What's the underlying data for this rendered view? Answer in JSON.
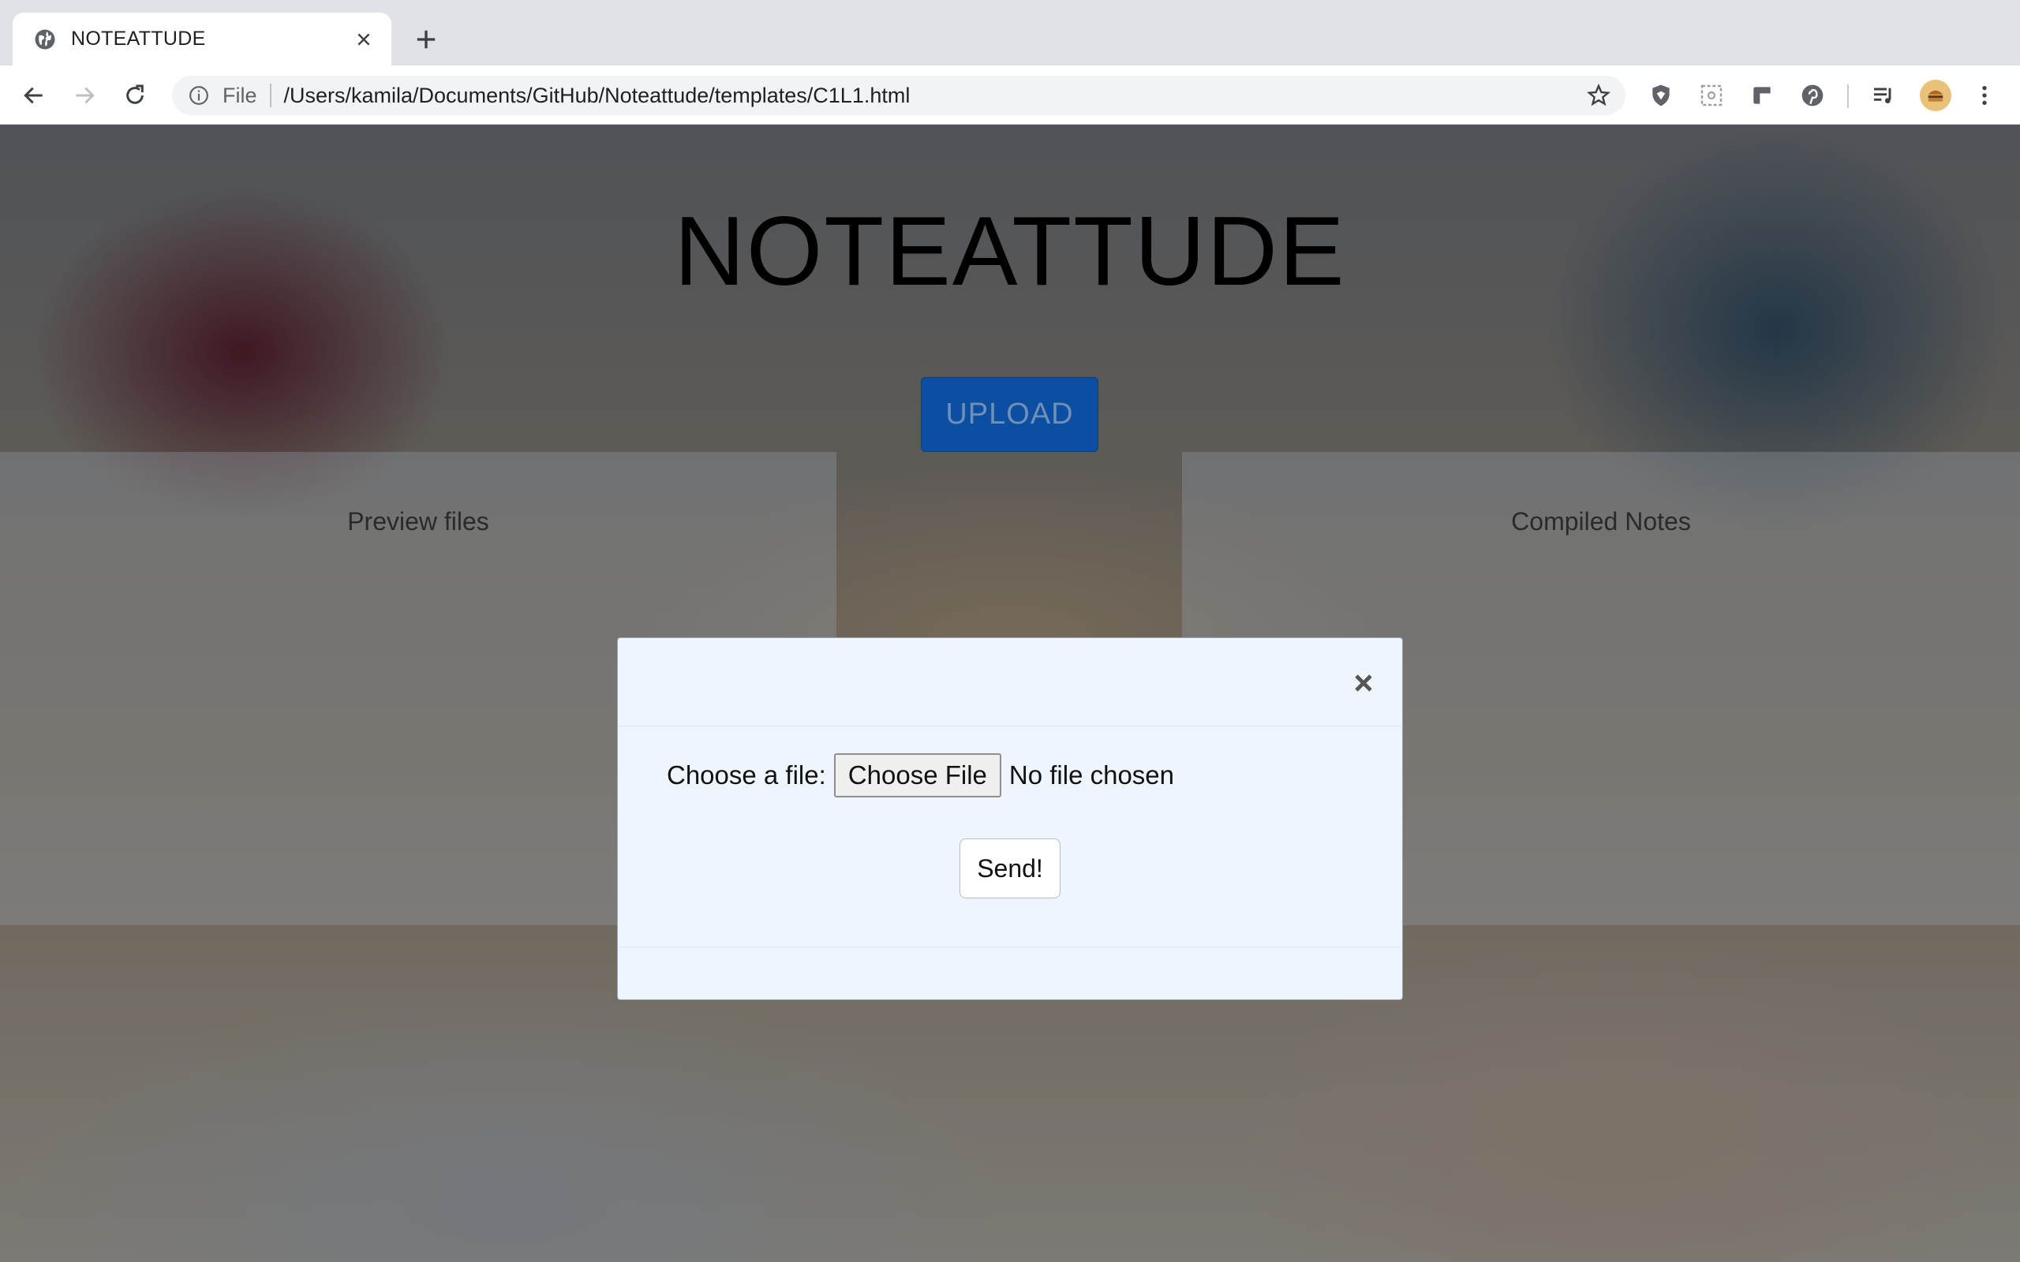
{
  "browser": {
    "tab_title": "NOTEATTUDE",
    "url_scheme": "File",
    "url_path": "/Users/kamila/Documents/GitHub/Noteattude/templates/C1L1.html"
  },
  "page": {
    "site_title": "NOTEATTUDE",
    "upload_label": "UPLOAD",
    "left_panel_title": "Preview files",
    "right_panel_title": "Compiled Notes"
  },
  "modal": {
    "file_label": "Choose a file:",
    "choose_button_label": "Choose File",
    "no_file_text": "No file chosen",
    "send_label": "Send!"
  },
  "colors": {
    "upload_button": "#0b4ea2",
    "modal_background": "#eef5fd"
  }
}
